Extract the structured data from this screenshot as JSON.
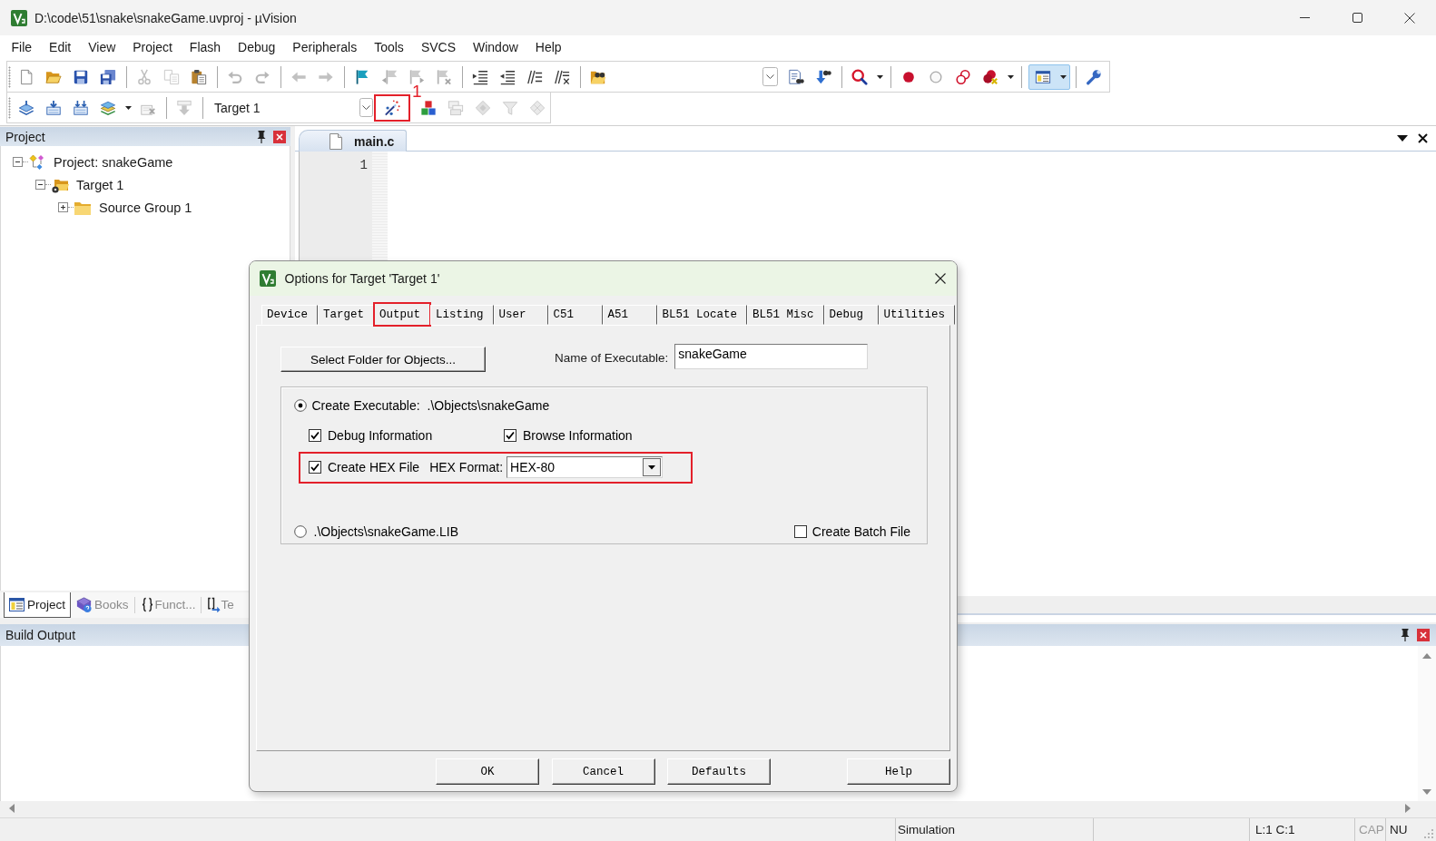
{
  "window": {
    "title": "D:\\code\\51\\snake\\snakeGame.uvproj - µVision"
  },
  "menu": [
    "File",
    "Edit",
    "View",
    "Project",
    "Flash",
    "Debug",
    "Peripherals",
    "Tools",
    "SVCS",
    "Window",
    "Help"
  ],
  "file_toolbar": {
    "groups": [
      [
        {
          "kind": "new",
          "disabled": false
        },
        {
          "kind": "open",
          "disabled": false
        },
        {
          "kind": "save",
          "disabled": false
        },
        {
          "kind": "save_all",
          "disabled": false
        }
      ],
      [
        {
          "kind": "cut",
          "disabled": true
        },
        {
          "kind": "copy",
          "disabled": true
        },
        {
          "kind": "paste",
          "disabled": false
        }
      ],
      [
        {
          "kind": "undo",
          "disabled": true
        },
        {
          "kind": "redo",
          "disabled": true
        }
      ],
      [
        {
          "kind": "back",
          "disabled": true
        },
        {
          "kind": "forward",
          "disabled": true
        }
      ],
      [
        {
          "kind": "bookmark",
          "disabled": false
        },
        {
          "kind": "bookmark_prev",
          "disabled": true
        },
        {
          "kind": "bookmark_next",
          "disabled": true
        },
        {
          "kind": "bookmark_clear",
          "disabled": true
        }
      ],
      [
        {
          "kind": "indent",
          "disabled": false
        },
        {
          "kind": "unindent",
          "disabled": false
        },
        {
          "kind": "comment",
          "disabled": false
        },
        {
          "kind": "uncomment",
          "disabled": false
        }
      ],
      [
        {
          "kind": "find_in_files",
          "disabled": false
        },
        {
          "kind": "find_combo",
          "disabled": false
        },
        {
          "kind": "find",
          "disabled": false
        },
        {
          "kind": "replace",
          "disabled": false
        }
      ],
      [
        {
          "kind": "debug",
          "disabled": false
        }
      ],
      [
        {
          "kind": "breakpoint",
          "disabled": false
        },
        {
          "kind": "bp_disable",
          "disabled": true
        },
        {
          "kind": "bp_toggle",
          "disabled": false
        },
        {
          "kind": "bp_kill",
          "disabled": false
        }
      ],
      [
        {
          "kind": "layout",
          "disabled": false,
          "pressed": true
        }
      ],
      [
        {
          "kind": "wrench",
          "disabled": false
        }
      ]
    ]
  },
  "build_toolbar": {
    "groups": [
      [
        {
          "kind": "translate",
          "disabled": false
        },
        {
          "kind": "build",
          "disabled": false
        },
        {
          "kind": "rebuild",
          "disabled": false
        },
        {
          "kind": "batch",
          "disabled": false
        },
        {
          "kind": "stop",
          "disabled": true
        }
      ],
      [
        {
          "kind": "download",
          "disabled": true
        }
      ]
    ],
    "target": "Target 1",
    "tools": [
      {
        "kind": "options",
        "disabled": false,
        "highlighted": true,
        "callout": "1"
      },
      {
        "kind": "manage",
        "disabled": false,
        "highlighted": false
      },
      {
        "kind": "windows",
        "disabled": true,
        "highlighted": false
      },
      {
        "kind": "diamond",
        "disabled": true,
        "highlighted": false
      },
      {
        "kind": "funnel",
        "disabled": true,
        "highlighted": false
      },
      {
        "kind": "packs",
        "disabled": true,
        "highlighted": false
      }
    ]
  },
  "project_panel": {
    "title": "Project",
    "tree": [
      {
        "label": "Project: snakeGame",
        "kind": "project",
        "expanded": true,
        "children": [
          {
            "label": "Target 1",
            "kind": "target",
            "expanded": true,
            "children": [
              {
                "label": "Source Group 1",
                "kind": "group",
                "expanded": false
              }
            ]
          }
        ]
      }
    ],
    "tabs": [
      {
        "label": "Project",
        "kind": "project",
        "selected": true
      },
      {
        "label": "Books",
        "kind": "books",
        "selected": false
      },
      {
        "label": "Funct...",
        "kind": "functions",
        "selected": false
      },
      {
        "label": "Te",
        "kind": "templates",
        "selected": false
      }
    ]
  },
  "editor": {
    "tabs": [
      {
        "label": "main.c",
        "selected": true
      }
    ],
    "line_numbers": [
      "1"
    ]
  },
  "build_output": {
    "title": "Build Output"
  },
  "status_bar": {
    "mode": "Simulation",
    "cursor": "L:1 C:1",
    "keys": [
      {
        "label": "CAP",
        "on": false
      },
      {
        "label": "NU",
        "on": true
      }
    ]
  },
  "dialog": {
    "title": "Options for Target 'Target 1'",
    "tabs": [
      {
        "label": "Device",
        "selected": false,
        "highlighted": false
      },
      {
        "label": "Target",
        "selected": false,
        "highlighted": false
      },
      {
        "label": "Output",
        "selected": true,
        "highlighted": true
      },
      {
        "label": "Listing",
        "selected": false,
        "highlighted": false
      },
      {
        "label": "User",
        "selected": false,
        "highlighted": false
      },
      {
        "label": "C51",
        "selected": false,
        "highlighted": false
      },
      {
        "label": "A51",
        "selected": false,
        "highlighted": false
      },
      {
        "label": "BL51 Locate",
        "selected": false,
        "highlighted": false
      },
      {
        "label": "BL51 Misc",
        "selected": false,
        "highlighted": false
      },
      {
        "label": "Debug",
        "selected": false,
        "highlighted": false
      },
      {
        "label": "Utilities",
        "selected": false,
        "highlighted": false
      }
    ],
    "select_folder_button": "Select Folder for Objects...",
    "executable_name": {
      "label": "Name of Executable:",
      "value": "snakeGame"
    },
    "output_kind": [
      {
        "label": "Create Executable:",
        "path": ".\\Objects\\snakeGame",
        "selected": true
      },
      {
        "label": ".\\Objects\\snakeGame.LIB",
        "selected": false
      }
    ],
    "debug_information": {
      "label": "Debug Information",
      "checked": true
    },
    "browse_information": {
      "label": "Browse Information",
      "checked": true
    },
    "hex_row": {
      "highlighted": true,
      "create_hex": {
        "label": "Create HEX File",
        "checked": true
      },
      "format_label": "HEX Format:",
      "format": "HEX-80"
    },
    "create_batch_file": {
      "label": "Create Batch File",
      "checked": false
    },
    "buttons": [
      "OK",
      "Cancel",
      "Defaults",
      "Help"
    ]
  }
}
